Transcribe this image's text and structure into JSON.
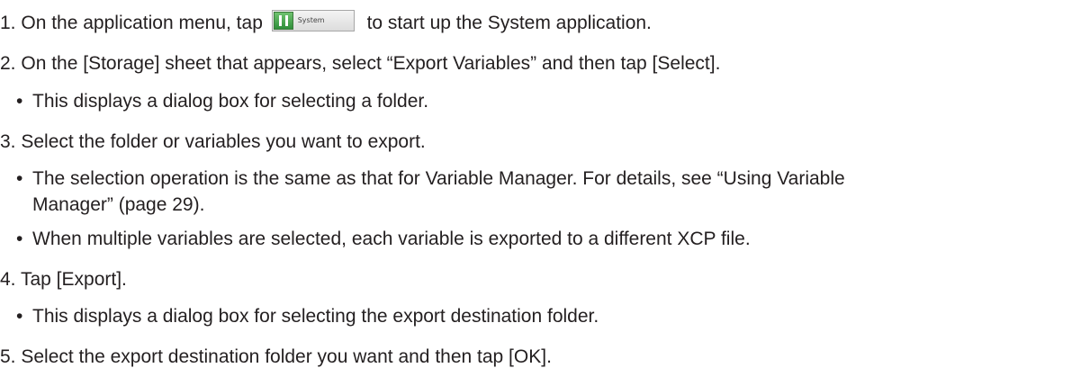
{
  "steps": [
    {
      "num": "1.",
      "text_before": "On the application menu, tap",
      "icon": {
        "name": "system-app-icon",
        "label": "System"
      },
      "text_after": "to start up the System application."
    },
    {
      "num": "2.",
      "text": "On the [Storage] sheet that appears, select “Export Variables” and then tap [Select].",
      "bullets": [
        "This displays a dialog box for selecting a folder."
      ]
    },
    {
      "num": "3.",
      "text": "Select the folder or variables you want to export.",
      "bullets": [
        "The selection operation is the same as that for Variable Manager. For details, see “Using Variable",
        "When multiple variables are selected, each variable is exported to a different XCP file."
      ],
      "bullet_continuation": "Manager” (page 29)."
    },
    {
      "num": "4.",
      "text": "Tap [Export].",
      "bullets": [
        "This displays a dialog box for selecting the export destination folder."
      ]
    },
    {
      "num": "5.",
      "text": "Select the export destination folder you want and then tap [OK]."
    }
  ],
  "bullet_glyph": "•"
}
